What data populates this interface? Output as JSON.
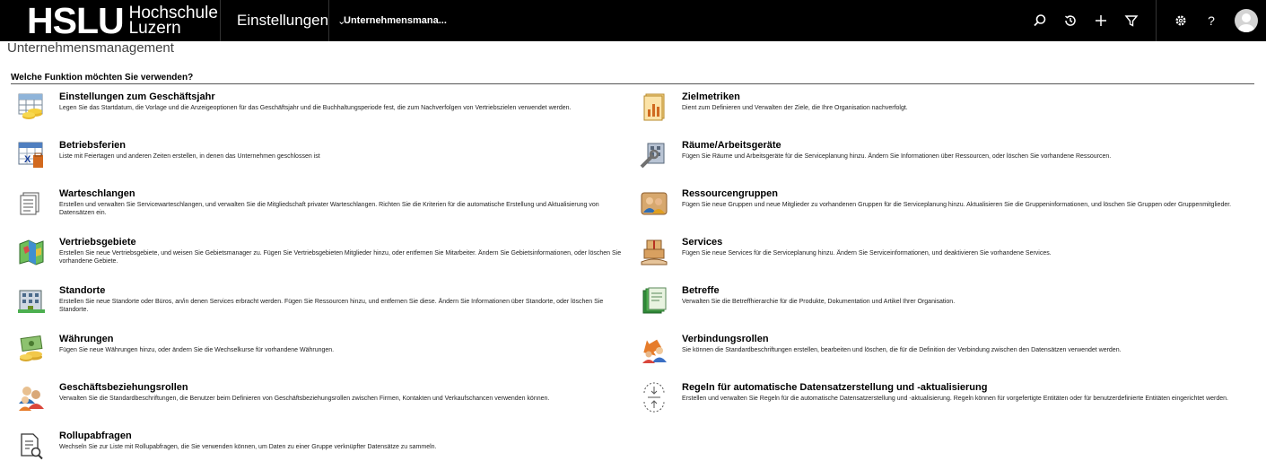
{
  "header": {
    "logo_mark": "HSLU",
    "logo_line1": "Hochschule",
    "logo_line2": "Luzern",
    "nav_label": "Einstellungen",
    "entity_label": "Unternehmensmana..."
  },
  "toolbar_icons": [
    "search-icon",
    "history-icon",
    "add-icon",
    "filter-icon",
    "gear-icon",
    "help-icon",
    "avatar"
  ],
  "page": {
    "title": "Unternehmensmanagement",
    "section_heading": "Welche Funktion möchten Sie verwenden?"
  },
  "left_items": [
    {
      "title": "Einstellungen zum Geschäftsjahr",
      "description": "Legen Sie das Startdatum, die Vorlage und die Anzeigeoptionen für das Geschäftsjahr und die Buchhaltungsperiode fest, die zum Nachverfolgen von Vertriebszielen verwendet werden.",
      "icon": "fiscal-year-icon"
    },
    {
      "title": "Betriebsferien",
      "description": "Liste mit Feiertagen und anderen Zeiten erstellen, in denen das Unternehmen geschlossen ist",
      "icon": "holiday-calendar-icon"
    },
    {
      "title": "Warteschlangen",
      "description": "Erstellen und verwalten Sie Servicewarteschlangen, und verwalten Sie die Mitgliedschaft privater Warteschlangen. Richten Sie die Kriterien für die automatische Erstellung und Aktualisierung von Datensätzen ein.",
      "icon": "queue-icon"
    },
    {
      "title": "Vertriebsgebiete",
      "description": "Erstellen Sie neue Vertriebsgebiete, und weisen Sie Gebietsmanager zu. Fügen Sie Vertriebsgebieten Mitglieder hinzu, oder entfernen Sie Mitarbeiter. Ändern Sie Gebietsinformationen, oder löschen Sie vorhandene Gebiete.",
      "icon": "territory-map-icon"
    },
    {
      "title": "Standorte",
      "description": "Erstellen Sie neue Standorte oder Büros, an/in denen Services erbracht werden. Fügen Sie Ressourcen hinzu, und entfernen Sie diese. Ändern Sie Informationen über Standorte, oder löschen Sie Standorte.",
      "icon": "site-building-icon"
    },
    {
      "title": "Währungen",
      "description": "Fügen Sie neue Währungen hinzu, oder ändern Sie die Wechselkurse für vorhandene Währungen.",
      "icon": "currency-icon"
    },
    {
      "title": "Geschäftsbeziehungsrollen",
      "description": "Verwalten Sie die Standardbeschriftungen, die Benutzer beim Definieren von Geschäftsbeziehungsrollen zwischen Firmen, Kontakten und Verkaufschancen verwenden können.",
      "icon": "relationship-roles-icon"
    },
    {
      "title": "Rollupabfragen",
      "description": "Wechseln Sie zur Liste mit Rollupabfragen, die Sie verwenden können, um Daten zu einer Gruppe verknüpfter Datensätze zu sammeln.",
      "icon": "rollup-query-icon"
    }
  ],
  "right_items": [
    {
      "title": "Zielmetriken",
      "description": "Dient zum Definieren und Verwalten der Ziele, die Ihre Organisation nachverfolgt.",
      "icon": "goal-metrics-icon"
    },
    {
      "title": "Räume/Arbeitsgeräte",
      "description": "Fügen Sie Räume und Arbeitsgeräte für die Serviceplanung hinzu. Ändern Sie Informationen über Ressourcen, oder löschen Sie vorhandene Ressourcen.",
      "icon": "facilities-equipment-icon"
    },
    {
      "title": "Ressourcengruppen",
      "description": "Fügen Sie neue Gruppen und neue Mitglieder zu vorhandenen Gruppen für die Serviceplanung hinzu. Aktualisieren Sie die Gruppeninformationen, und löschen Sie Gruppen oder Gruppenmitglieder.",
      "icon": "resource-groups-icon"
    },
    {
      "title": "Services",
      "description": "Fügen Sie neue Services für die Serviceplanung hinzu. Ändern Sie Serviceinformationen, und deaktivieren Sie vorhandene Services.",
      "icon": "services-icon"
    },
    {
      "title": "Betreffe",
      "description": "Verwalten Sie die Betreffhierarchie für die Produkte, Dokumentation und Artikel Ihrer Organisation.",
      "icon": "subjects-icon"
    },
    {
      "title": "Verbindungsrollen",
      "description": "Sie können die Standardbeschriftungen erstellen, bearbeiten und löschen, die für die Definition der Verbindung zwischen den Datensätzen verwendet werden.",
      "icon": "connection-roles-icon"
    },
    {
      "title": "Regeln für automatische Datensatzerstellung und -aktualisierung",
      "description": "Erstellen und verwalten Sie Regeln für die automatische Datensatzerstellung und -aktualisierung. Regeln können für vorgefertigte Entitäten oder für benutzerdefinierte Entitäten eingerichtet werden.",
      "icon": "record-rules-icon"
    }
  ]
}
